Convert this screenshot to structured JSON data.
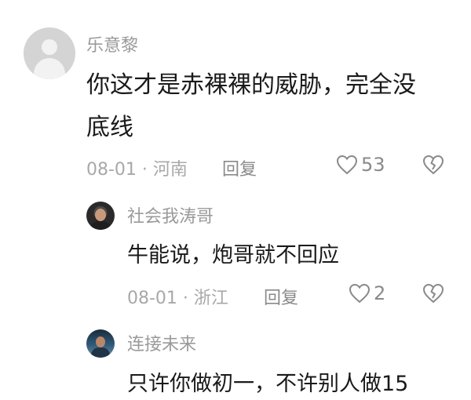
{
  "comments": [
    {
      "user": "乐意黎",
      "text_lines": [
        "你这才是赤裸裸的威胁，完全没",
        "底线"
      ],
      "meta": "08-01 · 河南",
      "reply_label": "回复",
      "likes": "53"
    },
    {
      "user": "社会我涛哥",
      "text": "牛能说，炮哥就不回应",
      "meta": "08-01 · 浙江",
      "reply_label": "回复",
      "likes": "2"
    },
    {
      "user": "连接未来",
      "text": "只许你做初一，不许别人做15"
    }
  ],
  "icons": {
    "like": "heart-outline-icon",
    "dislike": "broken-heart-icon"
  },
  "colors": {
    "text": "#1a1a1a",
    "username": "#9a9a9a",
    "meta": "#a8a8a8",
    "action": "#8a8a8a"
  }
}
